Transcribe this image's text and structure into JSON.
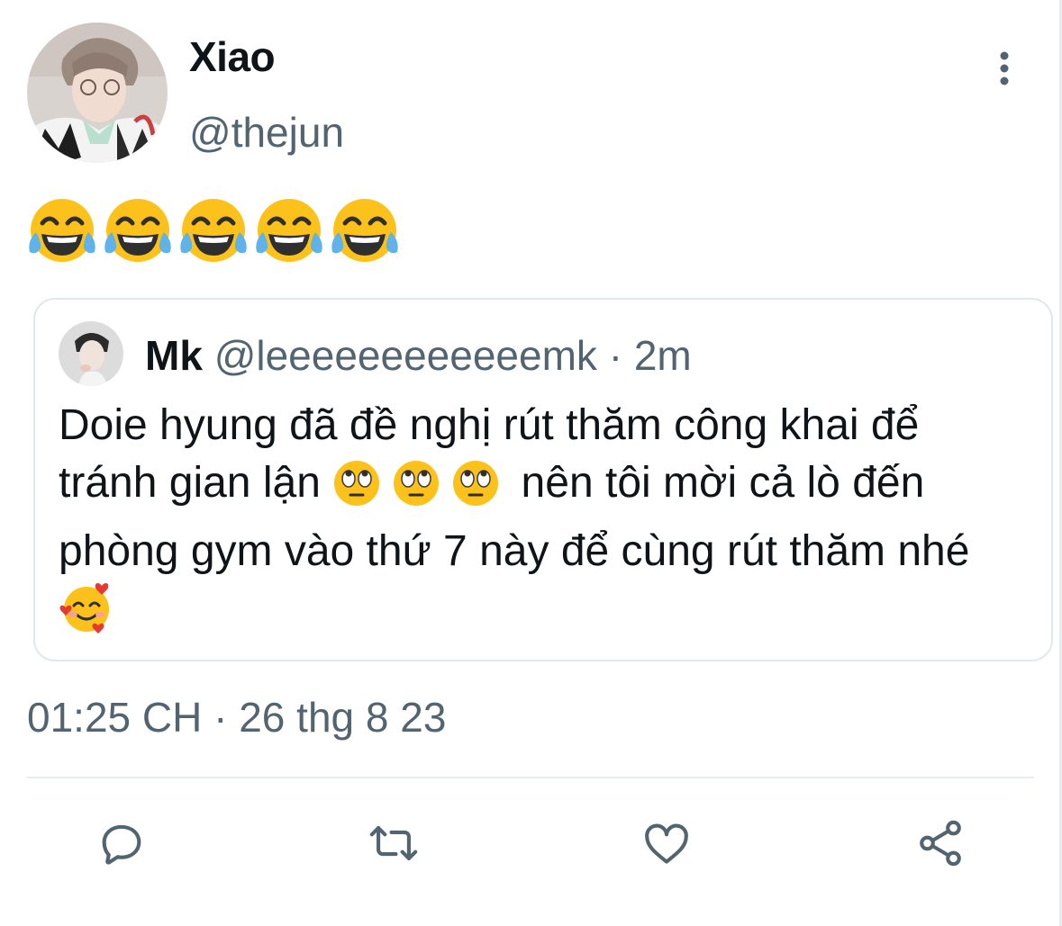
{
  "tweet": {
    "display_name": "Xiao",
    "handle": "@thejun",
    "text_emojis": [
      "face-with-tears-of-joy",
      "face-with-tears-of-joy",
      "face-with-tears-of-joy",
      "face-with-tears-of-joy",
      "face-with-tears-of-joy"
    ],
    "timestamp": "01:25 CH · 26 thg 8 23"
  },
  "quoted_tweet": {
    "display_name": "Mk",
    "handle": "@leeeeeeeeeeeemk",
    "separator": " · ",
    "time": "2m",
    "text_part1": "Doie hyung đã đề nghị rút thăm công khai để tránh gian lận ",
    "text_part2": " nên tôi mời cả lò đến phòng gym vào thứ 7 này để cùng rút thăm nhé ",
    "emojis_mid": [
      "face-with-rolling-eyes",
      "face-with-rolling-eyes",
      "face-with-rolling-eyes"
    ],
    "emoji_end": "smiling-face-with-hearts"
  },
  "actions": [
    "reply",
    "retweet",
    "like",
    "share"
  ],
  "colors": {
    "text_primary": "#0f1419",
    "text_secondary": "#536471",
    "border": "#e1e8ed",
    "icon": "#536471"
  }
}
